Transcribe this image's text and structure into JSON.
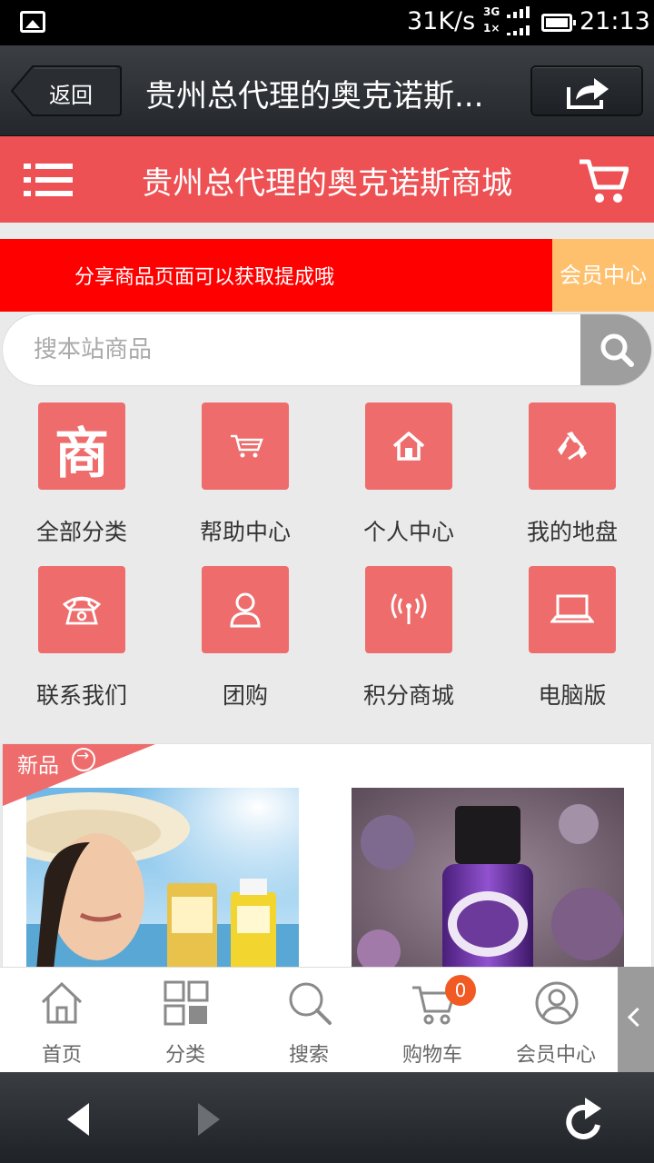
{
  "status_bar": {
    "speed": "31K/s",
    "net_top": "3G",
    "net_bottom": "1×",
    "time": "21:13"
  },
  "browser": {
    "back_label": "返回",
    "page_title": "贵州总代理的奥克诺斯..."
  },
  "header": {
    "site_title": "贵州总代理的奥克诺斯商城"
  },
  "promo": {
    "text": "分享商品页面可以获取提成哦",
    "member_center": "会员中心"
  },
  "search": {
    "placeholder": "搜本站商品"
  },
  "grid": [
    {
      "label": "全部分类",
      "icon": "shop-icon",
      "glyph": "商"
    },
    {
      "label": "帮助中心",
      "icon": "cart-icon"
    },
    {
      "label": "个人中心",
      "icon": "home-icon"
    },
    {
      "label": "我的地盘",
      "icon": "recycle-icon"
    },
    {
      "label": "联系我们",
      "icon": "phone-icon"
    },
    {
      "label": "团购",
      "icon": "user-icon"
    },
    {
      "label": "积分商城",
      "icon": "signal-icon"
    },
    {
      "label": "电脑版",
      "icon": "laptop-icon"
    }
  ],
  "new_products": {
    "label": "新品"
  },
  "bottom_nav": [
    {
      "label": "首页",
      "icon": "home-icon"
    },
    {
      "label": "分类",
      "icon": "category-icon"
    },
    {
      "label": "搜索",
      "icon": "search-icon"
    },
    {
      "label": "购物车",
      "icon": "cart-icon",
      "badge": "0"
    },
    {
      "label": "会员中心",
      "icon": "user-icon"
    }
  ],
  "colors": {
    "header": "#ee5153",
    "promo": "#ff0000",
    "member": "#ffc06e",
    "icon_bg": "#ee6c6c",
    "badge": "#f15a22"
  }
}
